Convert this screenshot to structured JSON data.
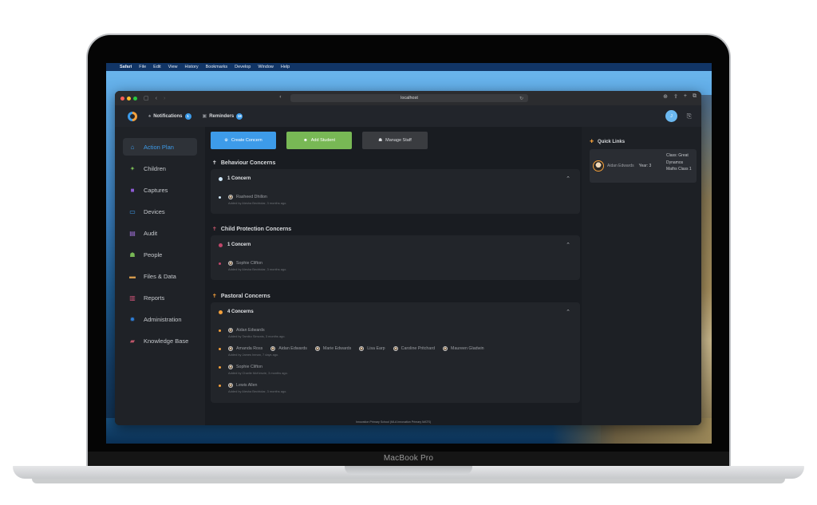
{
  "device": {
    "label": "MacBook Pro"
  },
  "menubar": {
    "items": [
      "Safari",
      "File",
      "Edit",
      "View",
      "History",
      "Bookmarks",
      "Develop",
      "Window",
      "Help"
    ]
  },
  "browser": {
    "url": "localhost",
    "traffic_lights": [
      "#ff5f57",
      "#febc2e",
      "#28c840"
    ]
  },
  "header": {
    "notifications": {
      "label": "Notifications",
      "count": "1"
    },
    "reminders": {
      "label": "Reminders",
      "count": "18"
    },
    "user_initial": "J"
  },
  "sidebar": {
    "items": [
      {
        "label": "Action Plan",
        "icon": "house-icon",
        "glyph": "⌂",
        "color": "#3d9be9",
        "active": true
      },
      {
        "label": "Children",
        "icon": "child-icon",
        "glyph": "✦",
        "color": "#78b855"
      },
      {
        "label": "Captures",
        "icon": "captures-icon",
        "glyph": "■",
        "color": "#8e5bd6"
      },
      {
        "label": "Devices",
        "icon": "devices-icon",
        "glyph": "▭",
        "color": "#3d9be9"
      },
      {
        "label": "Audit",
        "icon": "clipboard-icon",
        "glyph": "▤",
        "color": "#a070d8"
      },
      {
        "label": "People",
        "icon": "people-icon",
        "glyph": "☗",
        "color": "#78b855"
      },
      {
        "label": "Files & Data",
        "icon": "folder-icon",
        "glyph": "▬",
        "color": "#d39a4c"
      },
      {
        "label": "Reports",
        "icon": "chart-icon",
        "glyph": "▥",
        "color": "#d2557a"
      },
      {
        "label": "Administration",
        "icon": "gear-icon",
        "glyph": "✹",
        "color": "#2e7dd6"
      },
      {
        "label": "Knowledge Base",
        "icon": "book-icon",
        "glyph": "▰",
        "color": "#c0566a"
      }
    ]
  },
  "actions": {
    "create_concern": "Create Concern",
    "add_student": "Add Student",
    "manage_staff": "Manage Staff"
  },
  "sections": [
    {
      "title": "Behaviour Concerns",
      "icon_color": "#d8dadd",
      "count_label": "1 Concern",
      "dot_color": "#cfe6f7",
      "entries": [
        {
          "students": [
            "Rasheed Dhillon"
          ],
          "meta": "Added by Alesha Bechtolar, 3 months ago."
        }
      ]
    },
    {
      "title": "Child Protection Concerns",
      "icon_color": "#c0566a",
      "count_label": "1 Concern",
      "dot_color": "#c0466a",
      "entries": [
        {
          "students": [
            "Sophie Clifton"
          ],
          "meta": "Added by Alesha Bechtolar, 3 months ago."
        }
      ]
    },
    {
      "title": "Pastoral Concerns",
      "icon_color": "#f4a03b",
      "count_label": "4 Concerns",
      "dot_color": "#f4a03b",
      "entries": [
        {
          "students": [
            "Aidan Edwards"
          ],
          "meta": "Added by Tamiko Simonis, 3 months ago."
        },
        {
          "students": [
            "Amanda Ross",
            "Aidan Edwards",
            "Marie Edwards",
            "Lisa Earp",
            "Caroline Pritchard",
            "Maureen Gladwin"
          ],
          "meta": "Added by James Inman, 7 days ago."
        },
        {
          "students": [
            "Sophie Clifton"
          ],
          "meta": "Added by Charlie McKenzie, 3 months ago."
        },
        {
          "students": [
            "Lewis Allen"
          ],
          "meta": "Added by Alesha Bechtolar, 3 months ago."
        }
      ]
    }
  ],
  "footer": "Innovation Primary School (MLA Innovation Primary MATS)",
  "quick_links": {
    "title": "Quick Links",
    "student": {
      "name": "Aidan Edwards",
      "year": "Year: 3",
      "class": "Class: Great Dynamos Maths Class 1"
    }
  }
}
